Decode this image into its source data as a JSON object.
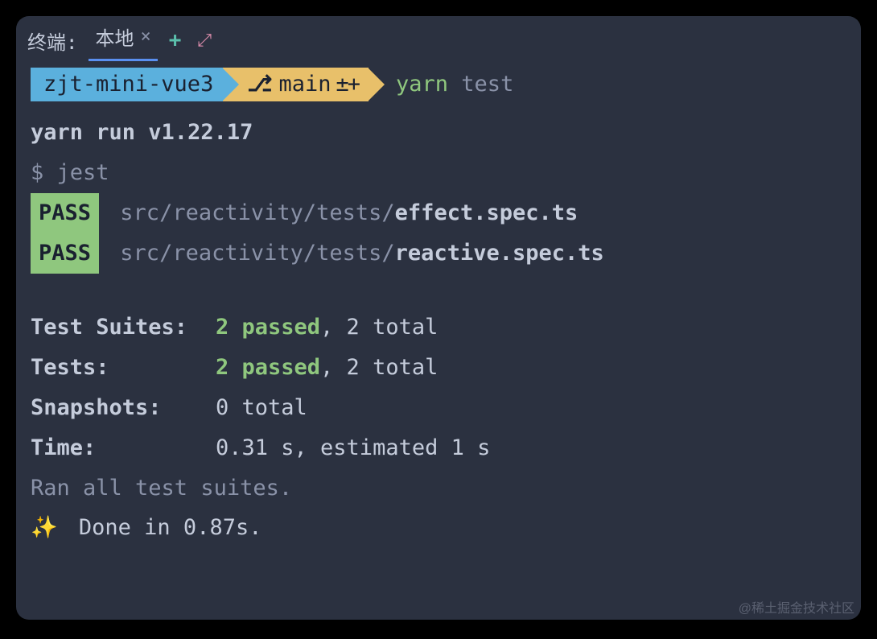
{
  "tabs": {
    "prefix": "终端:",
    "active_label": "本地",
    "close_symbol": "×",
    "add_symbol": "+",
    "expand_symbol": "⤢"
  },
  "prompt": {
    "project": "zjt-mini-vue3",
    "branch_icon": "⎇",
    "branch": "main",
    "branch_status": "±+",
    "command_yarn": "yarn",
    "command_test": "test"
  },
  "output": {
    "run_line": "yarn run v1.22.17",
    "jest_line": "$ jest",
    "pass_badge": "PASS",
    "results": [
      {
        "path": "src/reactivity/tests/",
        "file": "effect.spec.ts"
      },
      {
        "path": "src/reactivity/tests/",
        "file": "reactive.spec.ts"
      }
    ]
  },
  "summary": {
    "suites_label": "Test Suites:",
    "suites_passed": "2 passed",
    "suites_total": ", 2 total",
    "tests_label": "Tests:",
    "tests_passed": "2 passed",
    "tests_total": ", 2 total",
    "snapshots_label": "Snapshots:",
    "snapshots_value": "0 total",
    "time_label": "Time:",
    "time_value": "0.31 s, estimated 1 s",
    "ran_line": "Ran all test suites.",
    "done_sparkle": "✨",
    "done_text": "Done in 0.87s."
  },
  "watermark": "@稀土掘金技术社区"
}
